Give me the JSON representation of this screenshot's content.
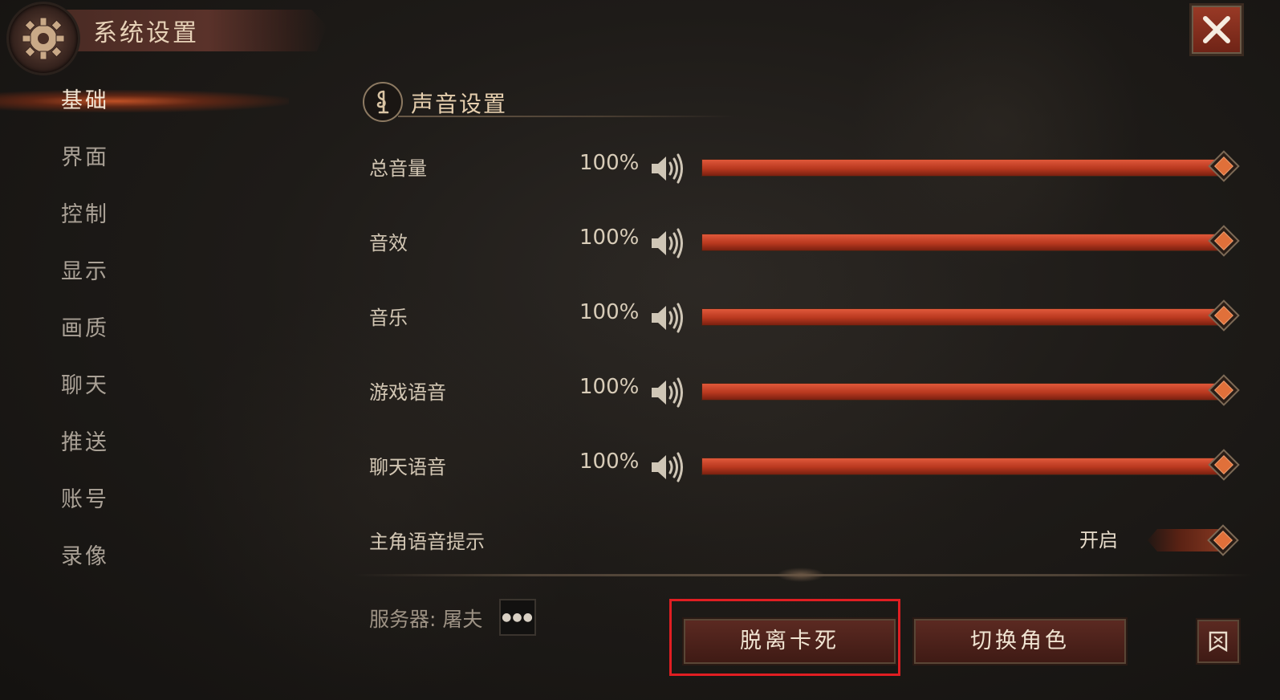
{
  "header": {
    "title": "系统设置"
  },
  "sidebar": {
    "items": [
      {
        "label": "基础",
        "active": true
      },
      {
        "label": "界面"
      },
      {
        "label": "控制"
      },
      {
        "label": "显示"
      },
      {
        "label": "画质"
      },
      {
        "label": "聊天"
      },
      {
        "label": "推送"
      },
      {
        "label": "账号"
      },
      {
        "label": "录像"
      }
    ]
  },
  "sound": {
    "section_title": "声音设置",
    "rows": [
      {
        "label": "总音量",
        "value": "100%",
        "level": 1.0
      },
      {
        "label": "音效",
        "value": "100%",
        "level": 1.0
      },
      {
        "label": "音乐",
        "value": "100%",
        "level": 1.0
      },
      {
        "label": "游戏语音",
        "value": "100%",
        "level": 1.0
      },
      {
        "label": "聊天语音",
        "value": "100%",
        "level": 1.0
      }
    ],
    "toggle": {
      "label": "主角语音提示",
      "state": "开启",
      "on": true
    }
  },
  "footer": {
    "server_label": "服务器: 屠夫",
    "unstuck_button": "脱离卡死",
    "switch_role_button": "切换角色"
  },
  "colors": {
    "accent": "#c8452a",
    "highlight_box": "#e01e22"
  },
  "icons": {
    "close": "close-icon",
    "gear": "gear-icon",
    "speaker": "speaker-icon",
    "music": "music-icon",
    "flag": "flag-icon"
  }
}
